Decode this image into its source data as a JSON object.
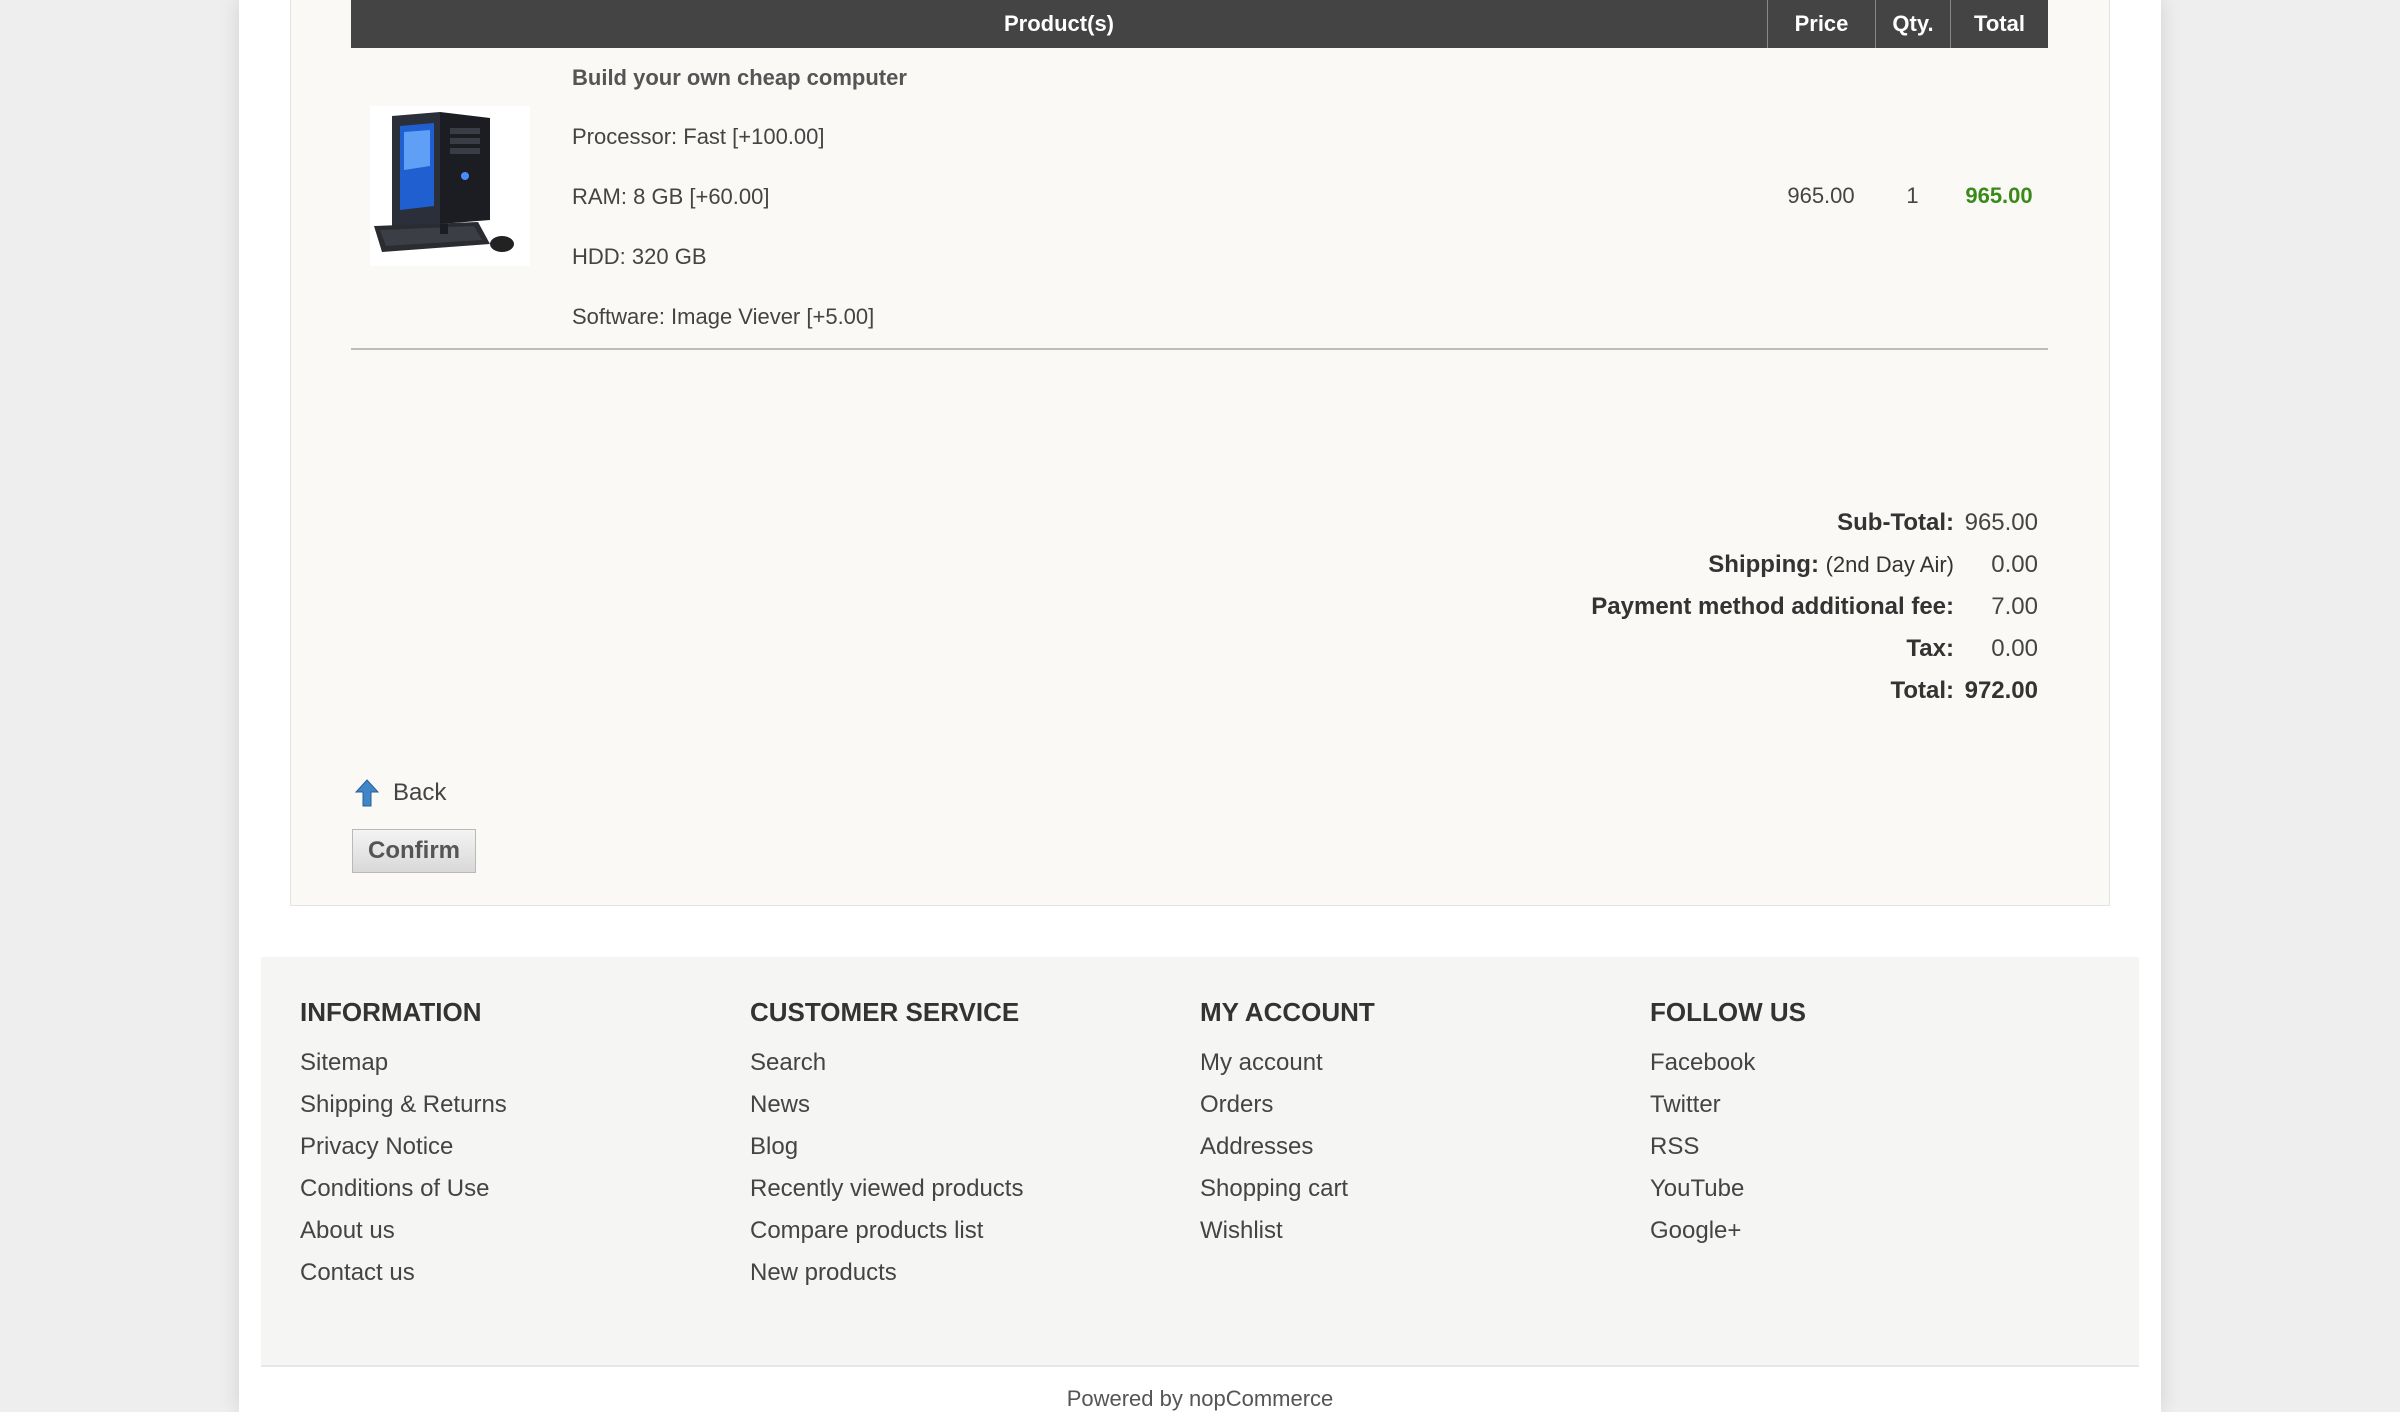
{
  "table": {
    "headers": {
      "product": "Product(s)",
      "price": "Price",
      "qty": "Qty.",
      "total": "Total"
    },
    "rows": [
      {
        "name": "Build your own cheap computer",
        "attributes": [
          "Processor: Fast [+100.00]",
          "RAM: 8 GB [+60.00]",
          "HDD: 320 GB",
          "Software: Image Viever [+5.00]"
        ],
        "price": "965.00",
        "qty": "1",
        "total": "965.00",
        "image_icon": "desktop-computer-image"
      }
    ]
  },
  "totals": {
    "subtotal_label": "Sub-Total:",
    "subtotal_value": "965.00",
    "shipping_label": "Shipping:",
    "shipping_method": "(2nd Day Air)",
    "shipping_value": "0.00",
    "payment_fee_label": "Payment method additional fee:",
    "payment_fee_value": "7.00",
    "tax_label": "Tax:",
    "tax_value": "0.00",
    "total_label": "Total:",
    "total_value": "972.00"
  },
  "actions": {
    "back_label": "Back",
    "back_icon": "up-arrow-icon",
    "confirm_label": "Confirm"
  },
  "footer": {
    "columns": [
      {
        "title": "INFORMATION",
        "items": [
          "Sitemap",
          "Shipping & Returns",
          "Privacy Notice",
          "Conditions of Use",
          "About us",
          "Contact us"
        ]
      },
      {
        "title": "CUSTOMER SERVICE",
        "items": [
          "Search",
          "News",
          "Blog",
          "Recently viewed products",
          "Compare products list",
          "New products"
        ]
      },
      {
        "title": "MY ACCOUNT",
        "items": [
          "My account",
          "Orders",
          "Addresses",
          "Shopping cart",
          "Wishlist"
        ]
      },
      {
        "title": "FOLLOW US",
        "items": [
          "Facebook",
          "Twitter",
          "RSS",
          "YouTube",
          "Google+"
        ]
      }
    ],
    "powered_by": "Powered by nopCommerce"
  },
  "colors": {
    "header_bg": "#444444",
    "total_green": "#3a8a1a",
    "page_bg": "#ffffff",
    "content_bg": "#faf9f6"
  }
}
